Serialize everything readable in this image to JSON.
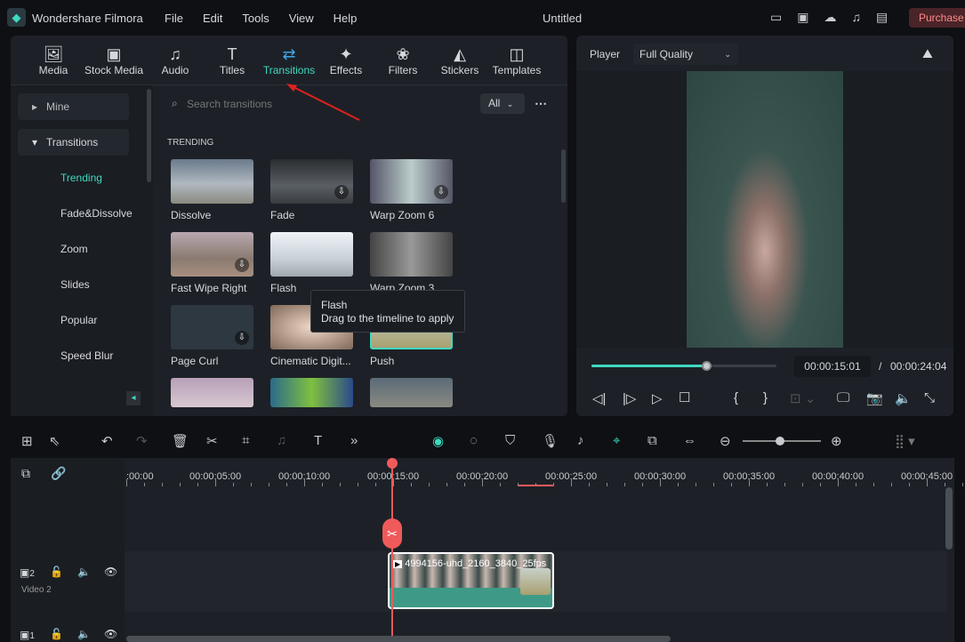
{
  "app": {
    "name": "Wondershare Filmora",
    "title": "Untitled",
    "purchase": "Purchase",
    "menu": [
      "File",
      "Edit",
      "Tools",
      "View",
      "Help"
    ]
  },
  "toolbar": [
    {
      "label": "Media",
      "icon": "media-icon"
    },
    {
      "label": "Stock Media",
      "icon": "stock-media-icon"
    },
    {
      "label": "Audio",
      "icon": "music-note-icon"
    },
    {
      "label": "Titles",
      "icon": "title-t-icon"
    },
    {
      "label": "Transitions",
      "icon": "transitions-icon",
      "active": true
    },
    {
      "label": "Effects",
      "icon": "effects-wand-icon"
    },
    {
      "label": "Filters",
      "icon": "filters-icon"
    },
    {
      "label": "Stickers",
      "icon": "stickers-icon"
    },
    {
      "label": "Templates",
      "icon": "templates-icon"
    }
  ],
  "sidebar": {
    "mine": "Mine",
    "transitions": "Transitions",
    "items": [
      "Trending",
      "Fade&Dissolve",
      "Zoom",
      "Slides",
      "Popular",
      "Speed Blur"
    ]
  },
  "search": {
    "placeholder": "Search transitions",
    "filter": "All"
  },
  "section": "TRENDING",
  "transitions": [
    "Dissolve",
    "Fade",
    "Warp Zoom 6",
    "Fast Wipe Right",
    "Flash",
    "Warp Zoom 3",
    "Page Curl",
    "Cinematic Digit...",
    "Push"
  ],
  "tooltip": {
    "title": "Flash",
    "hint": "Drag to the timeline to apply"
  },
  "player": {
    "label": "Player",
    "quality": "Full Quality",
    "current": "00:00:15:01",
    "total": "00:00:24:04",
    "separator": "/",
    "progress": 0.62
  },
  "timeline": {
    "ticks": [
      ":00:00",
      "00:00:05:00",
      "00:00:10:00",
      "00:00:15:00",
      "00:00:20:00",
      "00:00:25:00",
      "00:00:30:00",
      "00:00:35:00",
      "00:00:40:00",
      "00:00:45:00"
    ],
    "track2": {
      "num": "2",
      "name": "Video 2"
    },
    "track1": {
      "num": "1"
    },
    "clip": "4994156-uhd_2160_3840_25fps"
  },
  "colors": {
    "accent": "#3fd9c0",
    "playhead": "#f05a5a",
    "clip": "#3e9a86"
  }
}
